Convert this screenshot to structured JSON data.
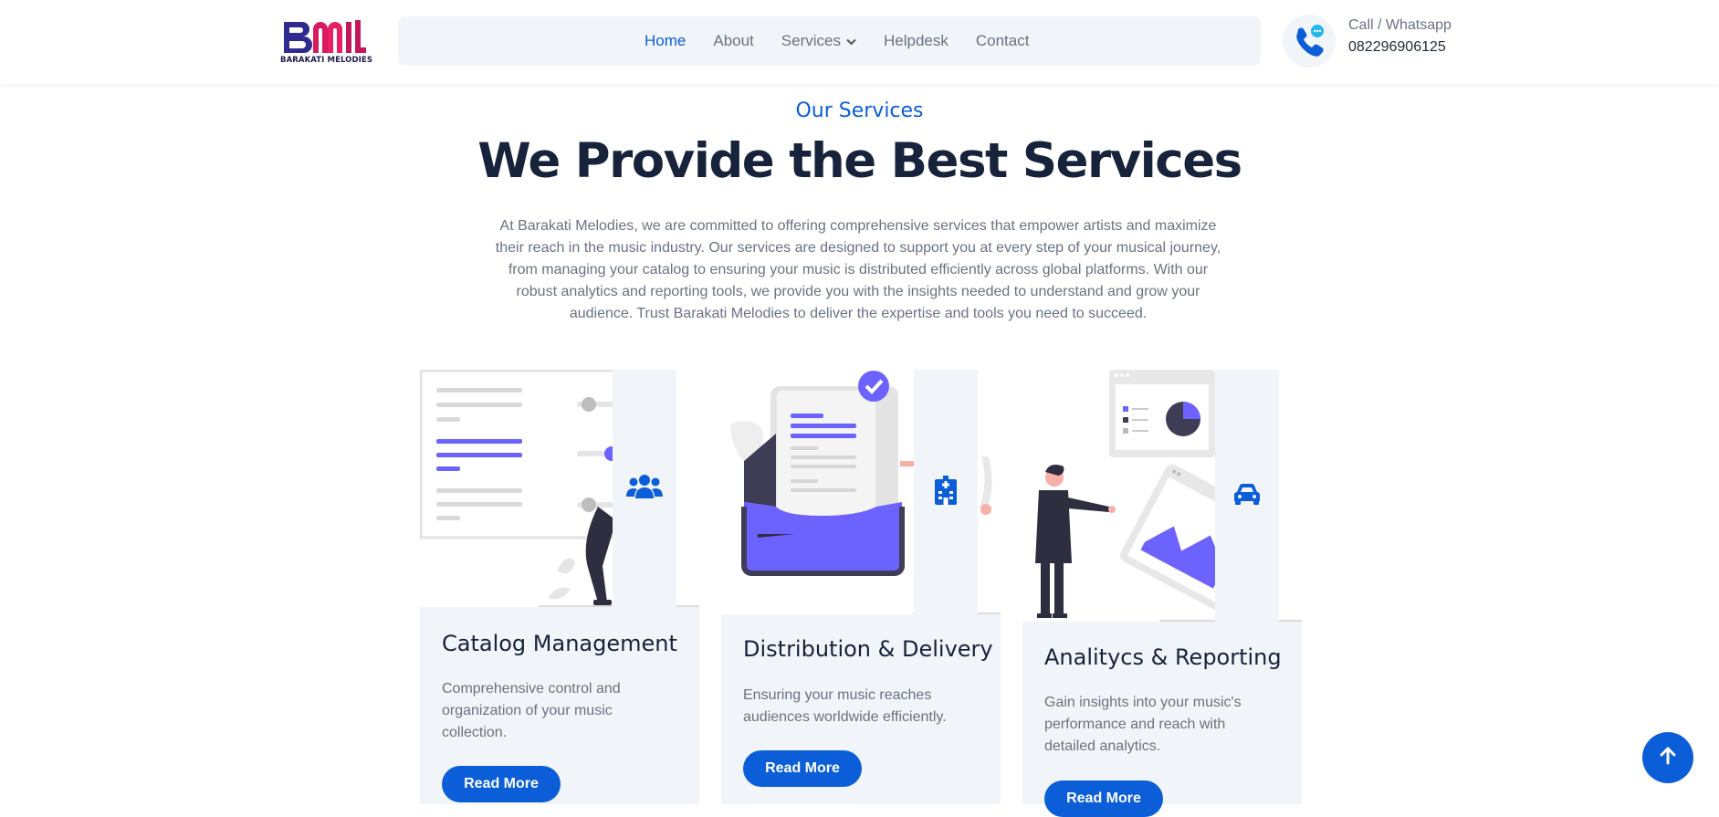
{
  "header": {
    "logo": {
      "monogram": "BM",
      "text": "BARAKATI MELODIES"
    },
    "nav": [
      {
        "label": "Home",
        "active": true
      },
      {
        "label": "About",
        "active": false
      },
      {
        "label": "Services",
        "active": false,
        "has_dropdown": true
      },
      {
        "label": "Helpdesk",
        "active": false
      },
      {
        "label": "Contact",
        "active": false
      }
    ],
    "contact": {
      "label": "Call / Whatsapp",
      "number": "082296906125",
      "icon": "phone-chat-icon"
    }
  },
  "section": {
    "eyebrow": "Our Services",
    "title": "We Provide the Best Services",
    "description": "At Barakati Melodies, we are committed to offering comprehensive services that empower artists and maximize their reach in the music industry. Our services are designed to support you at every step of your musical journey, from managing your catalog to ensuring your music is distributed efficiently across global platforms. With our robust analytics and reporting tools, we provide you with the insights needed to understand and grow your audience. Trust Barakati Melodies to deliver the expertise and tools you need to succeed."
  },
  "cards": [
    {
      "title": "Catalog Management",
      "text": "Comprehensive control and organization of your music collection.",
      "button": "Read More",
      "icon": "users-icon"
    },
    {
      "title": "Distribution & Delivery",
      "text": "Ensuring your music reaches audiences worldwide efficiently.",
      "button": "Read More",
      "icon": "hospital-icon"
    },
    {
      "title": "Analitycs & Reporting",
      "text": "Gain insights into your music's performance and reach with detailed analytics.",
      "button": "Read More",
      "icon": "car-icon"
    }
  ],
  "colors": {
    "accent": "#0b5ed7",
    "illustration": "#6c63ff",
    "heading": "#17223b",
    "card_bg": "#f1f4f8"
  },
  "scroll_top": {
    "icon": "arrow-up-icon"
  }
}
